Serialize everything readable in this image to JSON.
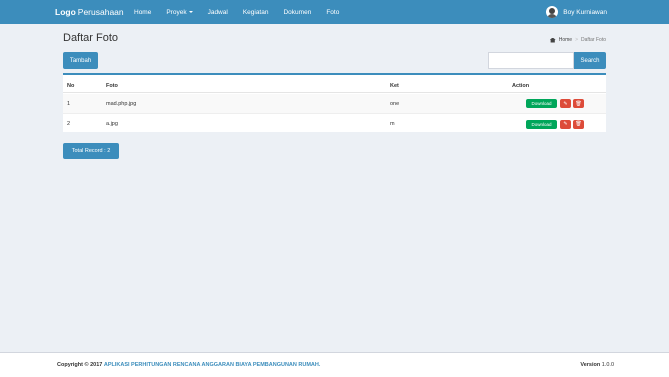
{
  "navbar": {
    "brand_bold": "Logo",
    "brand_rest": "Perusahaan",
    "menu": [
      "Home",
      "Proyek",
      "Jadwal",
      "Kegiatan",
      "Dokumen",
      "Foto"
    ],
    "user_name": "Boy Kurniawan",
    "color": "#3c8dbc"
  },
  "page": {
    "title": "Daftar Foto",
    "breadcrumb": {
      "home": "Home",
      "current": "Daftar Foto"
    }
  },
  "toolbar": {
    "add_label": "Tambah",
    "search_value": "",
    "search_label": "Search"
  },
  "table": {
    "headers": {
      "no": "No",
      "foto": "Foto",
      "ket": "Ket",
      "action": "Action"
    },
    "rows": [
      {
        "no": "1",
        "foto": "mad.php.jpg",
        "ket": "one"
      },
      {
        "no": "2",
        "foto": "a.jpg",
        "ket": "m"
      }
    ],
    "download_label": "Download",
    "edit_icon": "edit-icon",
    "delete_icon": "trash-icon"
  },
  "total_label": "Total Record : 2",
  "footer": {
    "copyright": "Copyright © 2017",
    "app_name": "APLIKASI PERHITUNGAN RENCANA ANGGARAN BIAYA PEMBANGUNAN RUMAH.",
    "version_label": "Version",
    "version_value": "1.0.0"
  }
}
